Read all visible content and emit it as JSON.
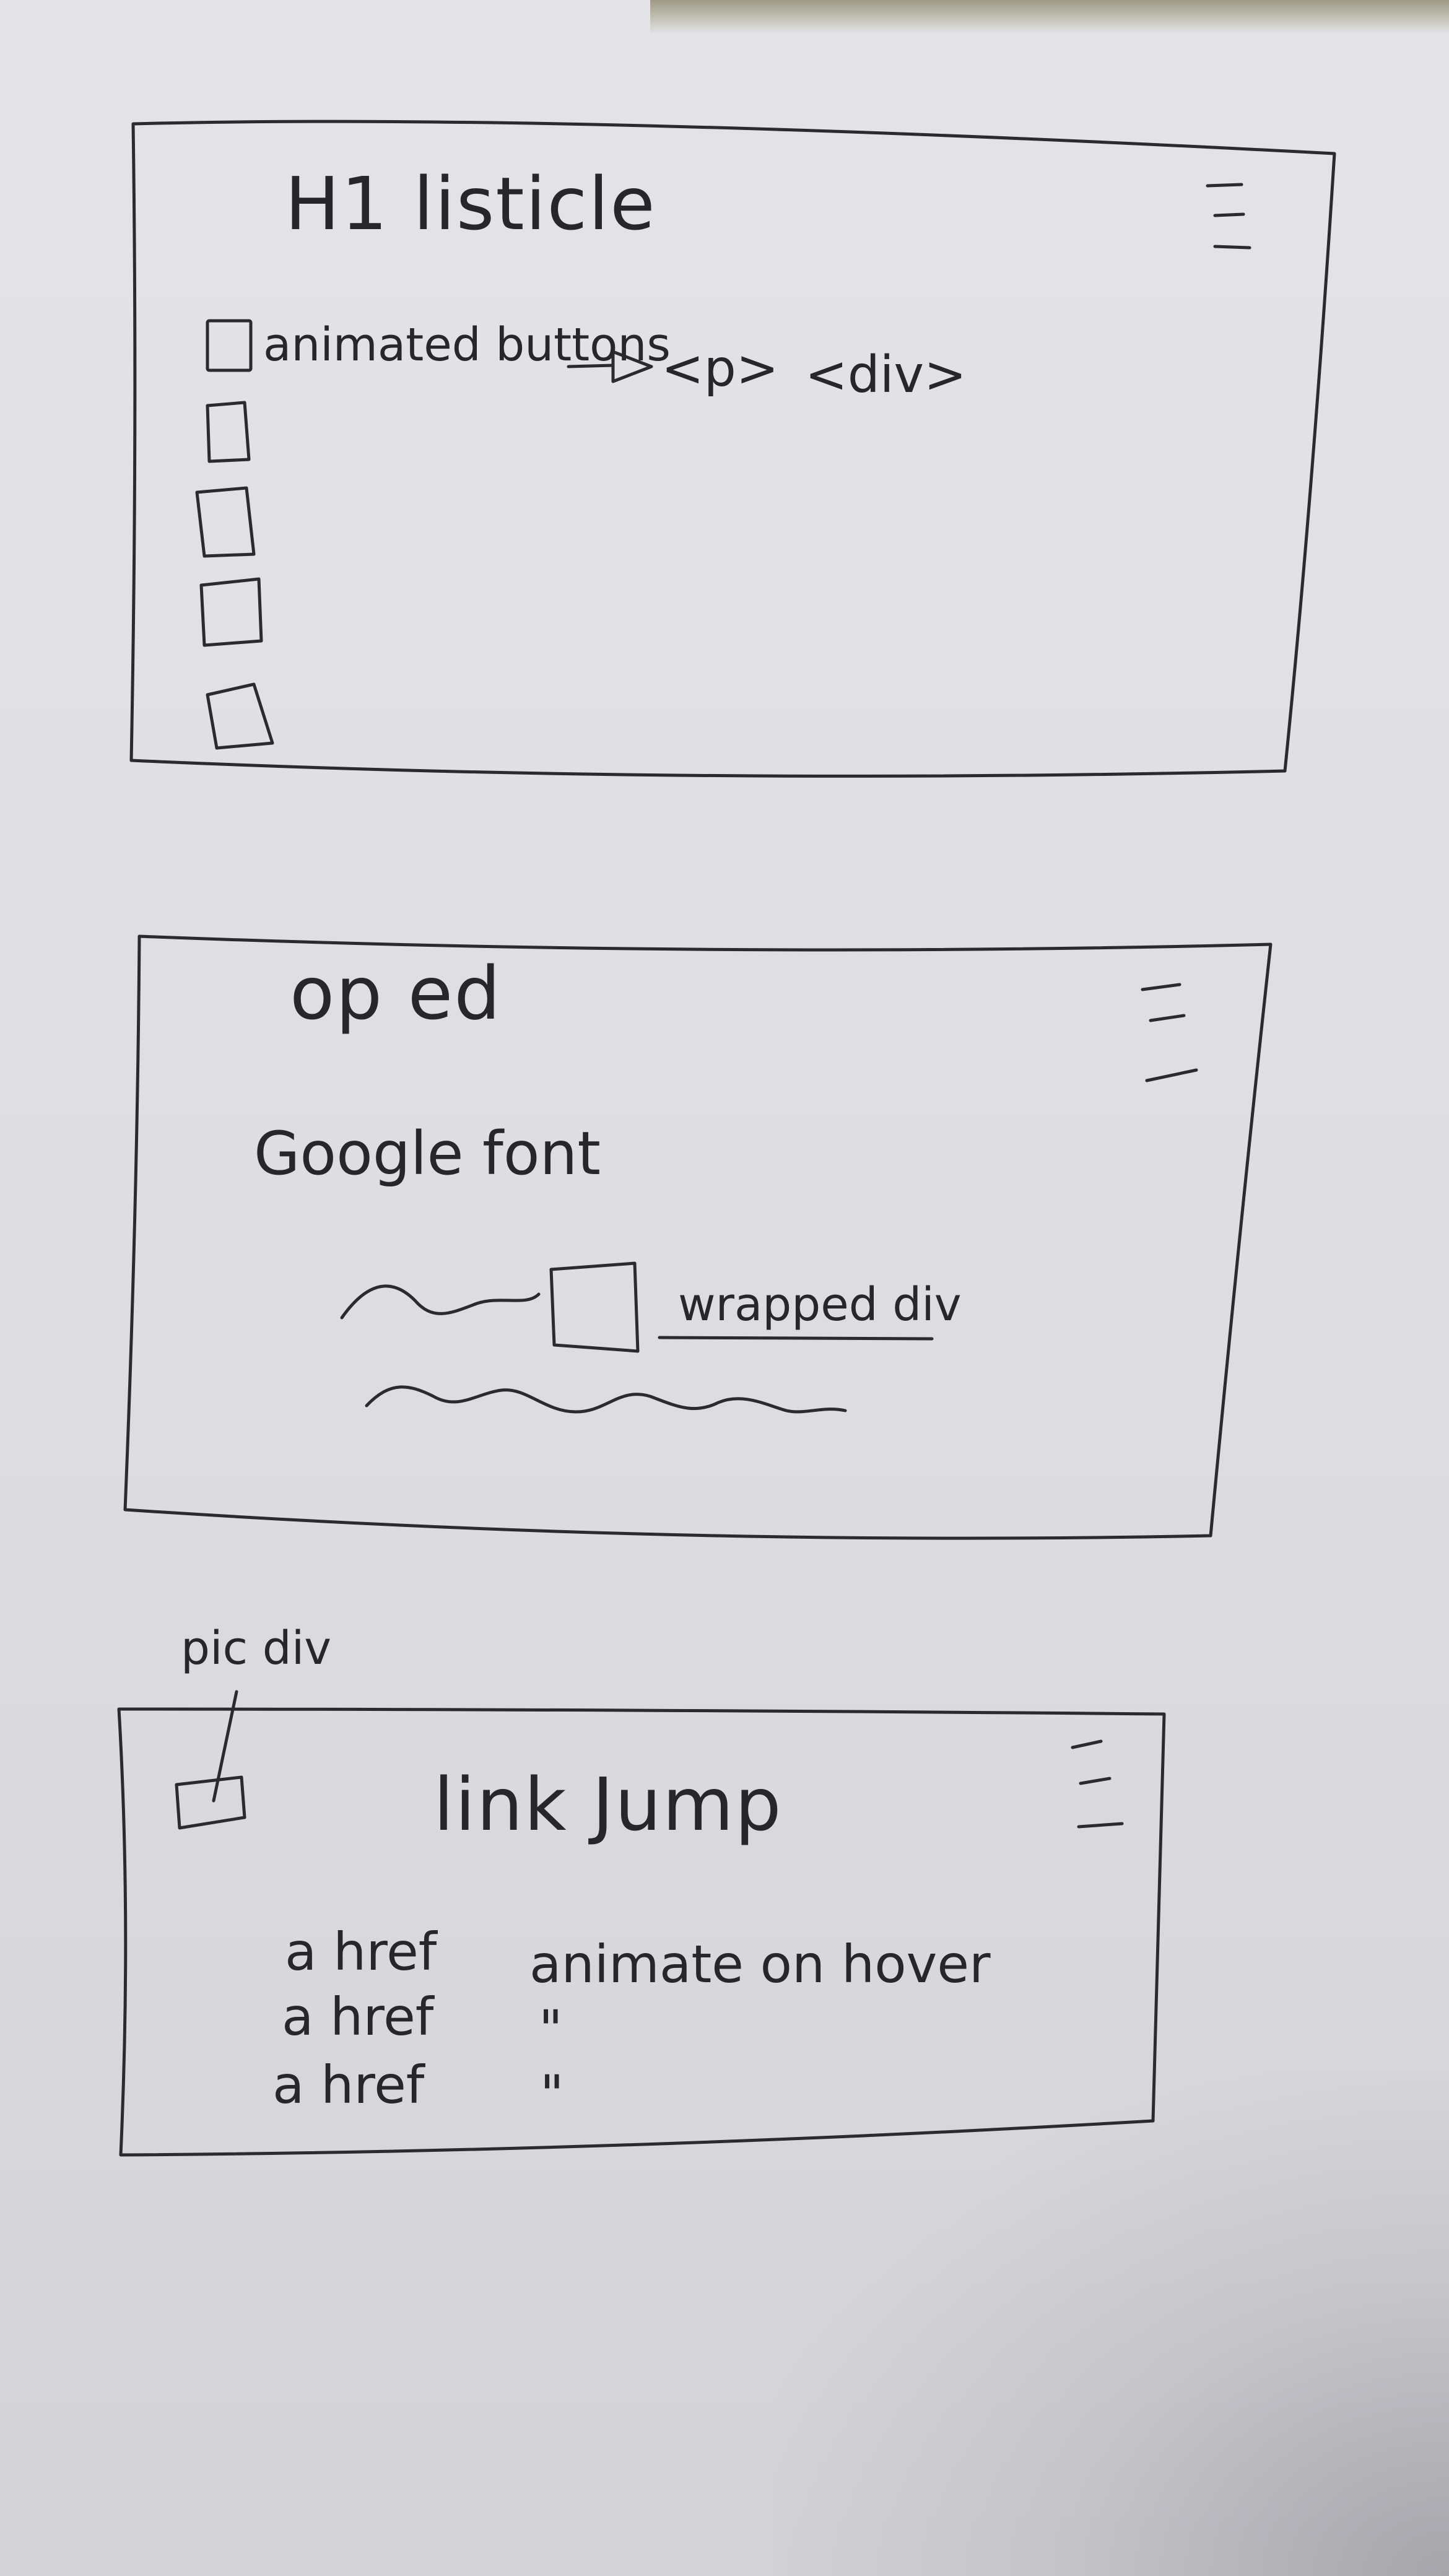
{
  "sketch": {
    "card1": {
      "title": "H1 listicle",
      "row_label": "animated buttons",
      "arrow": "→",
      "tag_p": "<p>",
      "tag_div": "<div>",
      "menu_icon": "hamburger-icon"
    },
    "card2": {
      "title": "op ed",
      "subtitle": "Google font",
      "wrapped_label": "wrapped div",
      "menu_icon": "hamburger-icon"
    },
    "card3": {
      "annotation": "pic div",
      "title": "link Jump",
      "links": [
        {
          "label": "a href",
          "note": "animate on hover"
        },
        {
          "label": "a href",
          "note": "\""
        },
        {
          "label": "a href",
          "note": "\""
        }
      ],
      "menu_icon": "hamburger-icon"
    }
  }
}
